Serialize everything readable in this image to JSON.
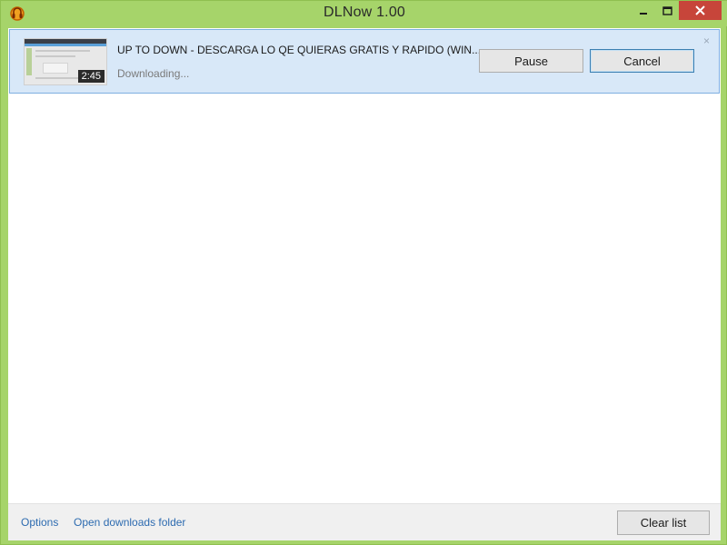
{
  "window": {
    "title": "DLNow 1.00",
    "controls": {
      "minimize": "—",
      "maximize": "□",
      "close": "✕"
    }
  },
  "download": {
    "title": "UP TO DOWN - DESCARGA LO QE QUIERAS GRATIS Y RAPIDO (WIN...",
    "status": "Downloading...",
    "duration": "2:45",
    "pause_label": "Pause",
    "cancel_label": "Cancel",
    "dismiss_label": "×"
  },
  "footer": {
    "options_label": "Options",
    "open_folder_label": "Open downloads folder",
    "clear_list_label": "Clear list"
  },
  "colors": {
    "frame": "#a6d46a",
    "item_bg": "#d8e8f8",
    "link": "#2d6bb0",
    "close_button": "#c7453a"
  }
}
